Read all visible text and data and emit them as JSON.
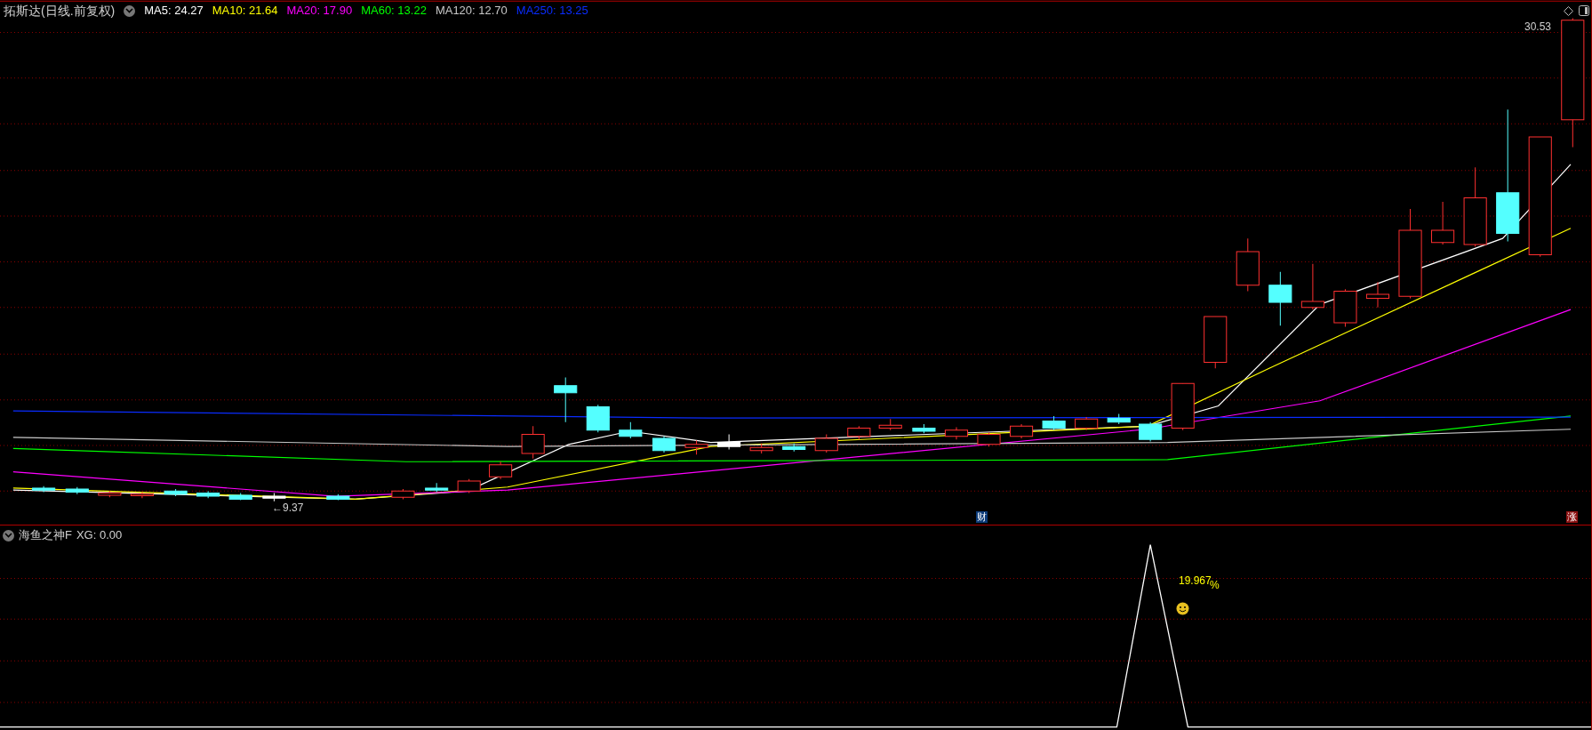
{
  "main_pane": {
    "title": "拓斯达(日线.前复权)",
    "ma_legend": [
      {
        "label": "MA5: 24.27",
        "color": "#ffffff"
      },
      {
        "label": "MA10: 21.64",
        "color": "#ffff00"
      },
      {
        "label": "MA20: 17.90",
        "color": "#ff00ff"
      },
      {
        "label": "MA60: 13.22",
        "color": "#00ff00"
      },
      {
        "label": "MA120: 12.70",
        "color": "#c8c8c8"
      },
      {
        "label": "MA250: 13.25",
        "color": "#0a2cff"
      }
    ],
    "price_high": "30.53",
    "price_low": "←9.37",
    "badges": [
      {
        "text": "财",
        "kind": "finance"
      },
      {
        "text": "涨",
        "kind": "limit_up"
      }
    ]
  },
  "indicator_pane": {
    "title": "海鱼之神F",
    "reading": "XG: 0.00",
    "signal_value": "19.967",
    "signal_unit": "%"
  }
}
